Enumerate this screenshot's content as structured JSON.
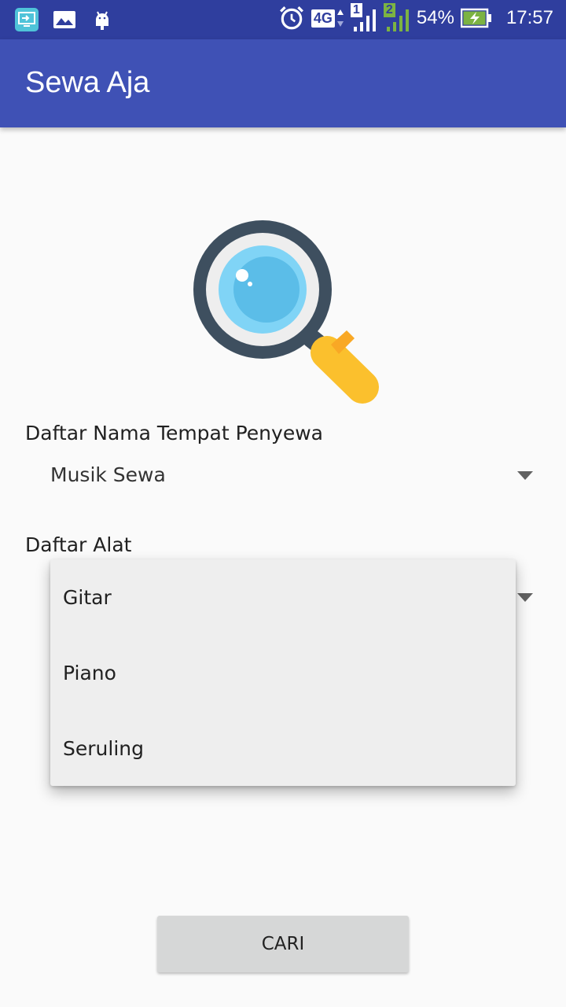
{
  "status_bar": {
    "battery_percent": "54%",
    "time": "17:57",
    "network_type": "4G",
    "sim1_label": "1",
    "sim2_label": "2",
    "left_icons": [
      "screen-cast-icon",
      "image-notification-icon",
      "android-debug-icon"
    ],
    "right_icons": [
      "alarm-icon",
      "network-4g-icon",
      "signal-sim1-icon",
      "signal-sim2-icon",
      "battery-charging-icon"
    ]
  },
  "app_bar": {
    "title": "Sewa Aja",
    "color": "#3f51b5"
  },
  "hero": {
    "icon": "magnifier-search-icon"
  },
  "form": {
    "tempat_label": "Daftar Nama Tempat Penyewa",
    "tempat_selected": "Musik Sewa",
    "alat_label": "Daftar Alat"
  },
  "dropdown": {
    "items": [
      {
        "label": "Gitar"
      },
      {
        "label": "Piano"
      },
      {
        "label": "Seruling"
      }
    ]
  },
  "actions": {
    "cari_label": "CARI"
  }
}
